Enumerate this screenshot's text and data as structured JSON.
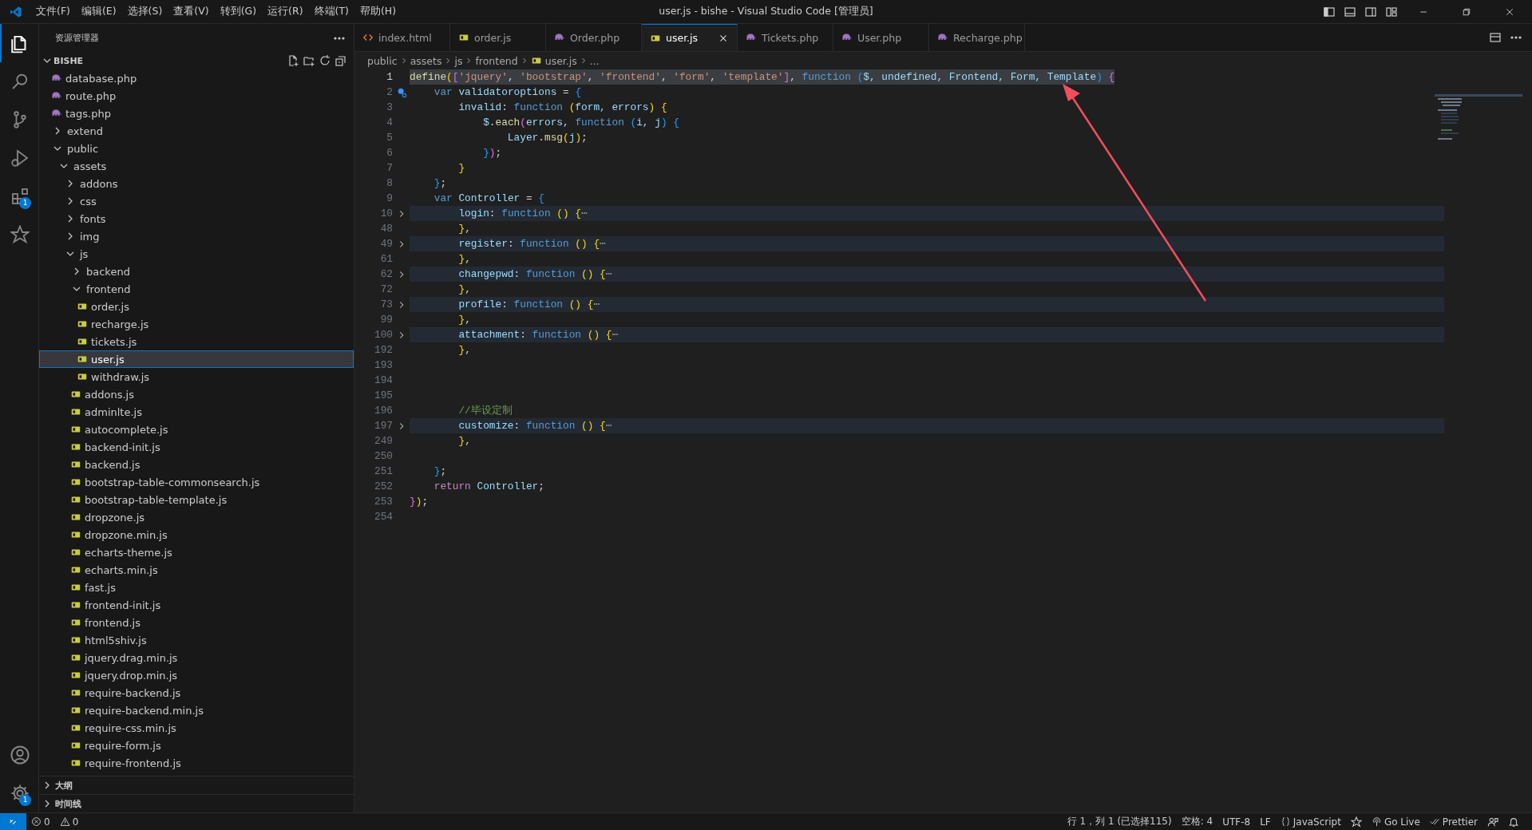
{
  "title_bar": {
    "menu": [
      "文件(F)",
      "编辑(E)",
      "选择(S)",
      "查看(V)",
      "转到(G)",
      "运行(R)",
      "终端(T)",
      "帮助(H)"
    ],
    "title": "user.js - bishe - Visual Studio Code [管理员]"
  },
  "activity_bar": {
    "items": [
      {
        "kind": "explorer",
        "selected": true
      },
      {
        "kind": "search",
        "selected": false
      },
      {
        "kind": "source-control",
        "selected": false
      },
      {
        "kind": "run-debug",
        "selected": false
      },
      {
        "kind": "extensions",
        "selected": false,
        "badge": "1"
      },
      {
        "kind": "plugin",
        "selected": false
      }
    ],
    "bottom": [
      {
        "kind": "account",
        "selected": false
      },
      {
        "kind": "manage",
        "selected": false,
        "badge": "1"
      }
    ]
  },
  "sidebar": {
    "title": "资源管理器",
    "root": {
      "label": "BISHE",
      "expanded": true,
      "items": [
        {
          "label": "database.php",
          "kind": "php",
          "selected": false
        },
        {
          "label": "route.php",
          "kind": "php",
          "selected": false
        },
        {
          "label": "tags.php",
          "kind": "php",
          "selected": false
        },
        {
          "label": "extend",
          "kind": "folder",
          "expanded": false,
          "selected": false
        },
        {
          "label": "public",
          "kind": "folder",
          "expanded": true,
          "selected": false,
          "children": [
            {
              "label": "assets",
              "kind": "folder",
              "expanded": true,
              "selected": false,
              "children": [
                {
                  "label": "addons",
                  "kind": "folder",
                  "expanded": false,
                  "selected": false
                },
                {
                  "label": "css",
                  "kind": "folder",
                  "expanded": false,
                  "selected": false
                },
                {
                  "label": "fonts",
                  "kind": "folder",
                  "expanded": false,
                  "selected": false
                },
                {
                  "label": "img",
                  "kind": "folder",
                  "expanded": false,
                  "selected": false
                },
                {
                  "label": "js",
                  "kind": "folder",
                  "expanded": true,
                  "selected": false,
                  "children": [
                    {
                      "label": "backend",
                      "kind": "folder",
                      "expanded": false,
                      "selected": false
                    },
                    {
                      "label": "frontend",
                      "kind": "folder",
                      "expanded": true,
                      "selected": false,
                      "children": [
                        {
                          "label": "order.js",
                          "kind": "js",
                          "selected": false
                        },
                        {
                          "label": "recharge.js",
                          "kind": "js",
                          "selected": false
                        },
                        {
                          "label": "tickets.js",
                          "kind": "js",
                          "selected": false
                        },
                        {
                          "label": "user.js",
                          "kind": "js",
                          "selected": true
                        },
                        {
                          "label": "withdraw.js",
                          "kind": "js",
                          "selected": false
                        }
                      ]
                    },
                    {
                      "label": "addons.js",
                      "kind": "js",
                      "selected": false
                    },
                    {
                      "label": "adminlte.js",
                      "kind": "js",
                      "selected": false
                    },
                    {
                      "label": "autocomplete.js",
                      "kind": "js",
                      "selected": false
                    },
                    {
                      "label": "backend-init.js",
                      "kind": "js",
                      "selected": false
                    },
                    {
                      "label": "backend.js",
                      "kind": "js",
                      "selected": false
                    },
                    {
                      "label": "bootstrap-table-commonsearch.js",
                      "kind": "js",
                      "selected": false
                    },
                    {
                      "label": "bootstrap-table-template.js",
                      "kind": "js",
                      "selected": false
                    },
                    {
                      "label": "dropzone.js",
                      "kind": "js",
                      "selected": false
                    },
                    {
                      "label": "dropzone.min.js",
                      "kind": "js",
                      "selected": false
                    },
                    {
                      "label": "echarts-theme.js",
                      "kind": "js",
                      "selected": false
                    },
                    {
                      "label": "echarts.min.js",
                      "kind": "js",
                      "selected": false
                    },
                    {
                      "label": "fast.js",
                      "kind": "js",
                      "selected": false
                    },
                    {
                      "label": "frontend-init.js",
                      "kind": "js",
                      "selected": false
                    },
                    {
                      "label": "frontend.js",
                      "kind": "js",
                      "selected": false
                    },
                    {
                      "label": "html5shiv.js",
                      "kind": "js",
                      "selected": false
                    },
                    {
                      "label": "jquery.drag.min.js",
                      "kind": "js",
                      "selected": false
                    },
                    {
                      "label": "jquery.drop.min.js",
                      "kind": "js",
                      "selected": false
                    },
                    {
                      "label": "require-backend.js",
                      "kind": "js",
                      "selected": false
                    },
                    {
                      "label": "require-backend.min.js",
                      "kind": "js",
                      "selected": false
                    },
                    {
                      "label": "require-css.min.js",
                      "kind": "js",
                      "selected": false
                    },
                    {
                      "label": "require-form.js",
                      "kind": "js",
                      "selected": false
                    },
                    {
                      "label": "require-frontend.js",
                      "kind": "js",
                      "selected": false
                    }
                  ]
                }
              ]
            }
          ]
        }
      ]
    },
    "sections": [
      {
        "label": "大纲",
        "expanded": false
      },
      {
        "label": "时间线",
        "expanded": false
      }
    ]
  },
  "tabs": [
    {
      "label": "index.html",
      "kind": "html",
      "selected": false
    },
    {
      "label": "order.js",
      "kind": "js",
      "selected": false
    },
    {
      "label": "Order.php",
      "kind": "php",
      "selected": false
    },
    {
      "label": "user.js",
      "kind": "js",
      "selected": true
    },
    {
      "label": "Tickets.php",
      "kind": "php",
      "selected": false
    },
    {
      "label": "User.php",
      "kind": "php",
      "selected": false
    },
    {
      "label": "Recharge.php",
      "kind": "php",
      "selected": false
    }
  ],
  "breadcrumbs": [
    {
      "label": "public",
      "kind": "folder"
    },
    {
      "label": "assets",
      "kind": "folder"
    },
    {
      "label": "js",
      "kind": "folder"
    },
    {
      "label": "frontend",
      "kind": "folder"
    },
    {
      "label": "user.js",
      "kind": "js"
    },
    {
      "label": "...",
      "kind": "more"
    }
  ],
  "editor": {
    "lines": [
      {
        "number": "1",
        "selected": true,
        "folded": false,
        "lightbulb": false,
        "tokens": [
          {
            "text": "define",
            "kind": "func"
          },
          {
            "text": "(",
            "kind": "b1"
          },
          {
            "text": "[",
            "kind": "b2"
          },
          {
            "text": "'jquery'",
            "kind": "string"
          },
          {
            "text": ", ",
            "kind": "plain"
          },
          {
            "text": "'bootstrap'",
            "kind": "string"
          },
          {
            "text": ", ",
            "kind": "plain"
          },
          {
            "text": "'frontend'",
            "kind": "string"
          },
          {
            "text": ", ",
            "kind": "plain"
          },
          {
            "text": "'form'",
            "kind": "string"
          },
          {
            "text": ", ",
            "kind": "plain"
          },
          {
            "text": "'template'",
            "kind": "string"
          },
          {
            "text": "]",
            "kind": "b2"
          },
          {
            "text": ", ",
            "kind": "plain"
          },
          {
            "text": "function",
            "kind": "keyword"
          },
          {
            "text": " (",
            "kind": "b3"
          },
          {
            "text": "$, undefined, Frontend, Form, Template",
            "kind": "var"
          },
          {
            "text": ")",
            "kind": "b3"
          },
          {
            "text": " {",
            "kind": "b2"
          }
        ]
      },
      {
        "number": "2",
        "selected": false,
        "folded": false,
        "lightbulb": true,
        "tokens": [
          {
            "text": "    var",
            "kind": "keyword"
          },
          {
            "text": " validatoroptions",
            "kind": "var"
          },
          {
            "text": " = ",
            "kind": "plain"
          },
          {
            "text": "{",
            "kind": "b3"
          }
        ]
      },
      {
        "number": "3",
        "selected": false,
        "folded": false,
        "lightbulb": false,
        "tokens": [
          {
            "text": "        invalid",
            "kind": "var"
          },
          {
            "text": ": ",
            "kind": "plain"
          },
          {
            "text": "function",
            "kind": "keyword"
          },
          {
            "text": " (",
            "kind": "b1"
          },
          {
            "text": "form, errors",
            "kind": "var"
          },
          {
            "text": ")",
            "kind": "b1"
          },
          {
            "text": " {",
            "kind": "b1"
          }
        ]
      },
      {
        "number": "4",
        "selected": false,
        "folded": false,
        "lightbulb": false,
        "tokens": [
          {
            "text": "            $",
            "kind": "var"
          },
          {
            "text": ".",
            "kind": "plain"
          },
          {
            "text": "each",
            "kind": "func"
          },
          {
            "text": "(",
            "kind": "b2"
          },
          {
            "text": "errors, ",
            "kind": "var"
          },
          {
            "text": "function",
            "kind": "keyword"
          },
          {
            "text": " (",
            "kind": "b3"
          },
          {
            "text": "i, j",
            "kind": "var"
          },
          {
            "text": ")",
            "kind": "b3"
          },
          {
            "text": " {",
            "kind": "b3"
          }
        ]
      },
      {
        "number": "5",
        "selected": false,
        "folded": false,
        "lightbulb": false,
        "tokens": [
          {
            "text": "                Layer",
            "kind": "var"
          },
          {
            "text": ".",
            "kind": "plain"
          },
          {
            "text": "msg",
            "kind": "func"
          },
          {
            "text": "(",
            "kind": "b1"
          },
          {
            "text": "j",
            "kind": "var"
          },
          {
            "text": ")",
            "kind": "b1"
          },
          {
            "text": ";",
            "kind": "plain"
          }
        ]
      },
      {
        "number": "6",
        "selected": false,
        "folded": false,
        "lightbulb": false,
        "tokens": [
          {
            "text": "            }",
            "kind": "b3"
          },
          {
            "text": ")",
            "kind": "b2"
          },
          {
            "text": ";",
            "kind": "plain"
          }
        ]
      },
      {
        "number": "7",
        "selected": false,
        "folded": false,
        "lightbulb": false,
        "tokens": [
          {
            "text": "        }",
            "kind": "b1"
          }
        ]
      },
      {
        "number": "8",
        "selected": false,
        "folded": false,
        "lightbulb": false,
        "tokens": [
          {
            "text": "    }",
            "kind": "b3"
          },
          {
            "text": ";",
            "kind": "plain"
          }
        ]
      },
      {
        "number": "9",
        "selected": false,
        "folded": false,
        "lightbulb": false,
        "tokens": [
          {
            "text": "    var",
            "kind": "keyword"
          },
          {
            "text": " Controller",
            "kind": "var"
          },
          {
            "text": " = ",
            "kind": "plain"
          },
          {
            "text": "{",
            "kind": "b3"
          }
        ]
      },
      {
        "number": "10",
        "selected": false,
        "folded": true,
        "lightbulb": false,
        "tokens": [
          {
            "text": "        login",
            "kind": "var"
          },
          {
            "text": ": ",
            "kind": "plain"
          },
          {
            "text": "function",
            "kind": "keyword"
          },
          {
            "text": " ()",
            "kind": "b1"
          },
          {
            "text": " {",
            "kind": "b1"
          },
          {
            "text": "⋯",
            "kind": "fold"
          }
        ]
      },
      {
        "number": "48",
        "selected": false,
        "folded": false,
        "lightbulb": false,
        "tokens": [
          {
            "text": "        }",
            "kind": "b1"
          },
          {
            "text": ",",
            "kind": "plain"
          }
        ]
      },
      {
        "number": "49",
        "selected": false,
        "folded": true,
        "lightbulb": false,
        "tokens": [
          {
            "text": "        register",
            "kind": "var"
          },
          {
            "text": ": ",
            "kind": "plain"
          },
          {
            "text": "function",
            "kind": "keyword"
          },
          {
            "text": " ()",
            "kind": "b1"
          },
          {
            "text": " {",
            "kind": "b1"
          },
          {
            "text": "⋯",
            "kind": "fold"
          }
        ]
      },
      {
        "number": "61",
        "selected": false,
        "folded": false,
        "lightbulb": false,
        "tokens": [
          {
            "text": "        }",
            "kind": "b1"
          },
          {
            "text": ",",
            "kind": "plain"
          }
        ]
      },
      {
        "number": "62",
        "selected": false,
        "folded": true,
        "lightbulb": false,
        "tokens": [
          {
            "text": "        changepwd",
            "kind": "var"
          },
          {
            "text": ": ",
            "kind": "plain"
          },
          {
            "text": "function",
            "kind": "keyword"
          },
          {
            "text": " ()",
            "kind": "b1"
          },
          {
            "text": " {",
            "kind": "b1"
          },
          {
            "text": "⋯",
            "kind": "fold"
          }
        ]
      },
      {
        "number": "72",
        "selected": false,
        "folded": false,
        "lightbulb": false,
        "tokens": [
          {
            "text": "        }",
            "kind": "b1"
          },
          {
            "text": ",",
            "kind": "plain"
          }
        ]
      },
      {
        "number": "73",
        "selected": false,
        "folded": true,
        "lightbulb": false,
        "tokens": [
          {
            "text": "        profile",
            "kind": "var"
          },
          {
            "text": ": ",
            "kind": "plain"
          },
          {
            "text": "function",
            "kind": "keyword"
          },
          {
            "text": " ()",
            "kind": "b1"
          },
          {
            "text": " {",
            "kind": "b1"
          },
          {
            "text": "⋯",
            "kind": "fold"
          }
        ]
      },
      {
        "number": "99",
        "selected": false,
        "folded": false,
        "lightbulb": false,
        "tokens": [
          {
            "text": "        }",
            "kind": "b1"
          },
          {
            "text": ",",
            "kind": "plain"
          }
        ]
      },
      {
        "number": "100",
        "selected": false,
        "folded": true,
        "lightbulb": false,
        "tokens": [
          {
            "text": "        attachment",
            "kind": "var"
          },
          {
            "text": ": ",
            "kind": "plain"
          },
          {
            "text": "function",
            "kind": "keyword"
          },
          {
            "text": " ()",
            "kind": "b1"
          },
          {
            "text": " {",
            "kind": "b1"
          },
          {
            "text": "⋯",
            "kind": "fold"
          }
        ]
      },
      {
        "number": "192",
        "selected": false,
        "folded": false,
        "lightbulb": false,
        "tokens": [
          {
            "text": "        }",
            "kind": "b1"
          },
          {
            "text": ",",
            "kind": "plain"
          }
        ]
      },
      {
        "number": "193",
        "selected": false,
        "folded": false,
        "lightbulb": false
      },
      {
        "number": "194",
        "selected": false,
        "folded": false,
        "lightbulb": false
      },
      {
        "number": "195",
        "selected": false,
        "folded": false,
        "lightbulb": false
      },
      {
        "number": "196",
        "selected": false,
        "folded": false,
        "lightbulb": false,
        "tokens": [
          {
            "text": "        //毕设定制",
            "kind": "comment"
          }
        ]
      },
      {
        "number": "197",
        "selected": false,
        "folded": true,
        "lightbulb": false,
        "tokens": [
          {
            "text": "        customize",
            "kind": "var"
          },
          {
            "text": ": ",
            "kind": "plain"
          },
          {
            "text": "function",
            "kind": "keyword"
          },
          {
            "text": " ()",
            "kind": "b1"
          },
          {
            "text": " {",
            "kind": "b1"
          },
          {
            "text": "⋯",
            "kind": "fold"
          }
        ]
      },
      {
        "number": "249",
        "selected": false,
        "folded": false,
        "lightbulb": false,
        "tokens": [
          {
            "text": "        }",
            "kind": "b1"
          },
          {
            "text": ",",
            "kind": "plain"
          }
        ]
      },
      {
        "number": "250",
        "selected": false,
        "folded": false,
        "lightbulb": false
      },
      {
        "number": "251",
        "selected": false,
        "folded": false,
        "lightbulb": false,
        "tokens": [
          {
            "text": "    }",
            "kind": "b3"
          },
          {
            "text": ";",
            "kind": "plain"
          }
        ]
      },
      {
        "number": "252",
        "selected": false,
        "folded": false,
        "lightbulb": false,
        "tokens": [
          {
            "text": "    return",
            "kind": "control"
          },
          {
            "text": " Controller",
            "kind": "var"
          },
          {
            "text": ";",
            "kind": "plain"
          }
        ]
      },
      {
        "number": "253",
        "selected": false,
        "folded": false,
        "lightbulb": false,
        "tokens": [
          {
            "text": "}",
            "kind": "b2"
          },
          {
            "text": ")",
            "kind": "b1"
          },
          {
            "text": ";",
            "kind": "plain"
          }
        ]
      },
      {
        "number": "254",
        "selected": false,
        "folded": false,
        "lightbulb": false
      }
    ]
  },
  "status_bar": {
    "left": [
      {
        "kind": "errors",
        "text": "0"
      },
      {
        "kind": "warnings",
        "text": "0"
      }
    ],
    "right": [
      {
        "kind": "text",
        "text": "行 1，列 1 (已选择115)"
      },
      {
        "kind": "text",
        "text": "空格: 4"
      },
      {
        "kind": "text",
        "text": "UTF-8"
      },
      {
        "kind": "text",
        "text": "LF"
      },
      {
        "kind": "language",
        "text": "JavaScript"
      },
      {
        "kind": "plugin-icon"
      },
      {
        "kind": "golive",
        "text": "Go Live"
      },
      {
        "kind": "prettier",
        "text": "Prettier"
      },
      {
        "kind": "feedback-icon"
      },
      {
        "kind": "bell-icon"
      }
    ]
  }
}
